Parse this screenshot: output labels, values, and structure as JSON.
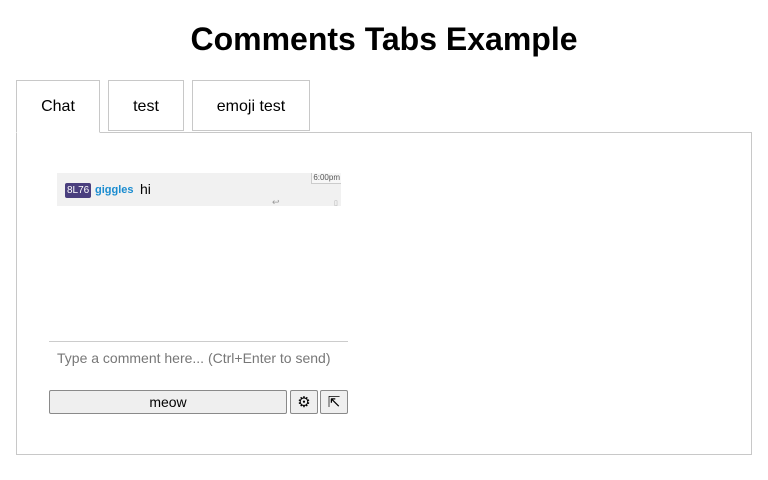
{
  "page": {
    "title": "Comments Tabs Example"
  },
  "tabs": [
    {
      "label": "Chat",
      "active": true
    },
    {
      "label": "test",
      "active": false
    },
    {
      "label": "emoji test",
      "active": false
    }
  ],
  "comments": [
    {
      "avatar": "8L76",
      "username": "giggles",
      "text": "hi",
      "time": "6:00pm",
      "avatar_color": "#4a3f7e",
      "username_color": "#1a8cd0"
    }
  ],
  "composer": {
    "placeholder": "Type a comment here... (Ctrl+Enter to send)",
    "value": "",
    "send_label": "meow",
    "settings_glyph": "⚙",
    "settings_icon": "gear-icon",
    "popout_glyph": "⇱",
    "popout_icon": "popout-icon"
  }
}
